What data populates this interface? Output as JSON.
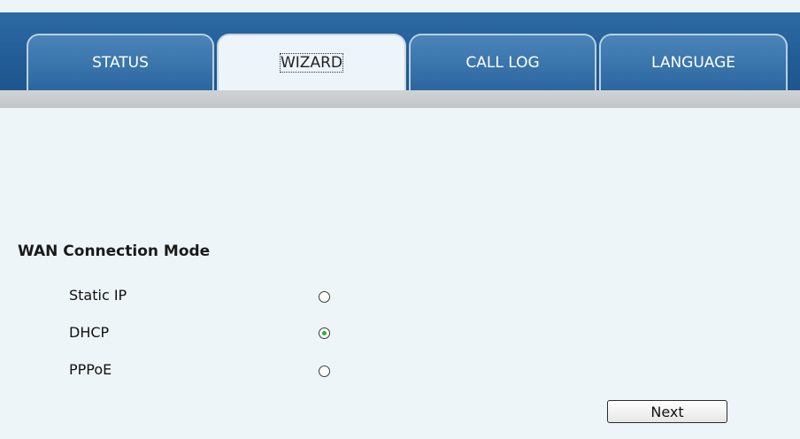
{
  "tabs": [
    {
      "label": "STATUS",
      "active": false
    },
    {
      "label": "WIZARD",
      "active": true
    },
    {
      "label": "CALL LOG",
      "active": false
    },
    {
      "label": "LANGUAGE",
      "active": false
    }
  ],
  "wan": {
    "title": "WAN Connection Mode",
    "options": [
      {
        "label": "Static IP",
        "checked": false
      },
      {
        "label": "DHCP",
        "checked": true
      },
      {
        "label": "PPPoE",
        "checked": false
      }
    ],
    "selected": "DHCP"
  },
  "actions": {
    "next_label": "Next"
  },
  "colors": {
    "tabbar_blue": "#225c96",
    "page_background": "#eef5f8",
    "radio_selected": "#2fae2f"
  }
}
